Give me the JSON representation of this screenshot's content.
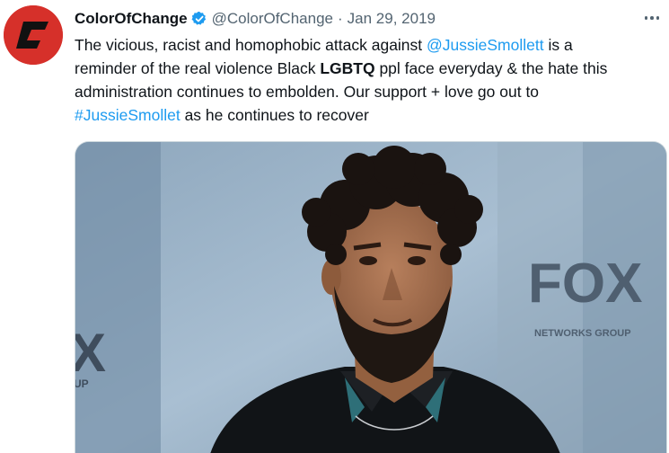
{
  "tweet": {
    "display_name": "ColorOfChange",
    "handle": "@ColorOfChange",
    "separator": "·",
    "date": "Jan 29, 2019",
    "verified_icon": "verified-badge-icon",
    "more_icon": "more-options-icon",
    "avatar_icon": "colorofchange-logo",
    "text": {
      "l1_a": "The vicious, racist and homophobic attack against ",
      "l1_mention": "@JussieSmollett",
      "l1_b": " is a",
      "l2_a": "reminder of the real violence Black ",
      "l2_bold": "LGBTQ",
      "l2_b": " ppl face everyday & the hate this",
      "l3": "administration continues to embolden. Our support + love go out to",
      "l4_hashtag": "#JussieSmollet",
      "l4_b": " as he continues to recover"
    },
    "media": {
      "backdrop_logo": "FOX",
      "backdrop_sub": "NETWORKS GROUP",
      "left_edge_x": "X",
      "left_edge_up": "UP",
      "description_icon": "photo-image"
    },
    "colors": {
      "link": "#1d9bf0",
      "verified": "#1d9bf0",
      "avatar_bg": "#d6302a",
      "secondary_text": "#536471"
    }
  }
}
